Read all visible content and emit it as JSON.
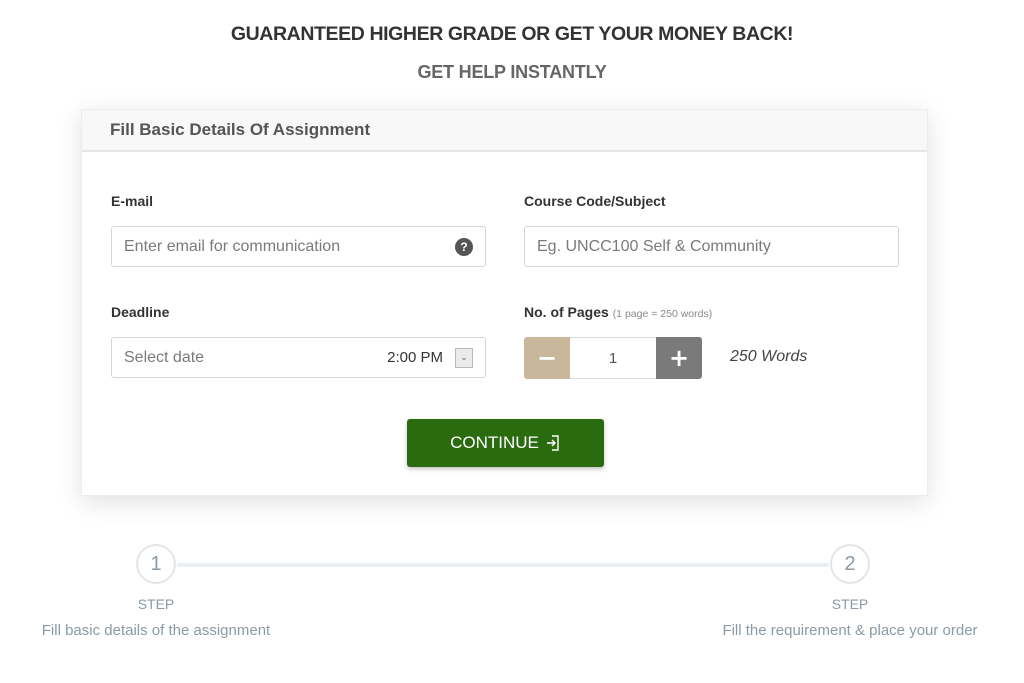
{
  "hero": {
    "headline": "GUARANTEED HIGHER GRADE OR GET YOUR MONEY BACK!",
    "subline": "GET HELP INSTANTLY"
  },
  "form": {
    "title": "Fill Basic Details Of Assignment",
    "email": {
      "label": "E-mail",
      "placeholder": "Enter email for communication",
      "value": "",
      "help_icon": "question-circle-icon",
      "help_glyph": "?"
    },
    "course": {
      "label": "Course Code/Subject",
      "placeholder": "Eg. UNCC100 Self & Community",
      "value": ""
    },
    "deadline": {
      "label": "Deadline",
      "placeholder": "Select date",
      "value": "",
      "time": "2:00 PM",
      "dropdown_icon": "chevron-down-icon",
      "dropdown_glyph": "⌄"
    },
    "pages": {
      "label": "No. of Pages",
      "hint": "(1 page = 250 words)",
      "value": "1",
      "minus_glyph": "−",
      "plus_glyph": "+",
      "words": "250 Words"
    },
    "continue": {
      "label": "CONTINUE",
      "icon": "sign-in-icon"
    }
  },
  "steps": {
    "progress": 0,
    "items": [
      {
        "number": "1",
        "label": "STEP",
        "description": "Fill basic details of the assignment"
      },
      {
        "number": "2",
        "label": "STEP",
        "description": "Fill the requirement & place your order"
      }
    ]
  },
  "colors": {
    "continue_bg": "#2a6b10",
    "minus_bg": "#c9b79b",
    "plus_bg": "#7a7a7a",
    "step_text": "#8a9aa6"
  }
}
